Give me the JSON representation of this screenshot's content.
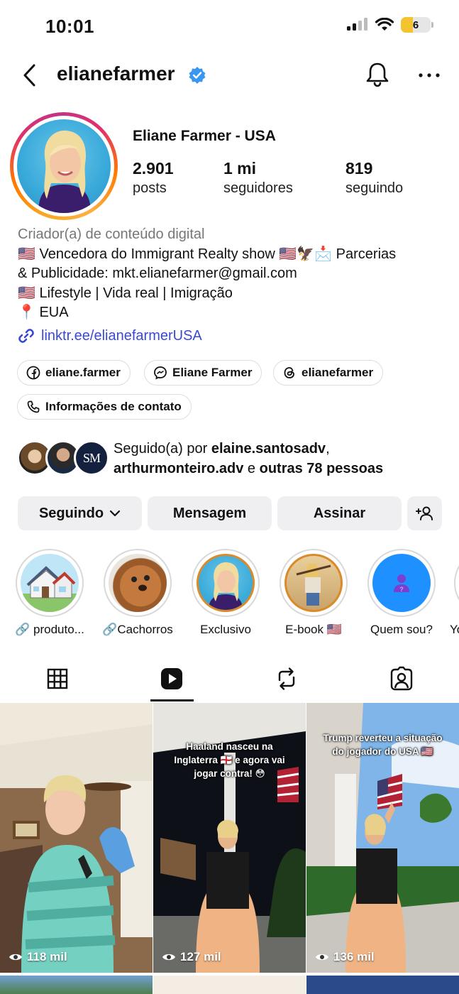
{
  "status": {
    "time": "10:01",
    "battery": "6"
  },
  "header": {
    "username": "elianefarmer"
  },
  "profile": {
    "display_name": "Eliane Farmer - USA",
    "stats": [
      {
        "value": "2.901",
        "label": "posts"
      },
      {
        "value": "1 mi",
        "label": "seguidores"
      },
      {
        "value": "819",
        "label": "seguindo"
      }
    ],
    "category": "Criador(a) de conteúdo digital",
    "bio_lines": [
      "🇺🇸 Vencedora do Immigrant Realty show 🇺🇸🦅📩 Parcerias",
      "& Publicidade: mkt.elianefarmer@gmail.com",
      "🇺🇸 Lifestyle | Vida real | Imigração",
      "📍 EUA"
    ],
    "link": "linktr.ee/elianefarmerUSA"
  },
  "chips": [
    {
      "label": "eliane.farmer",
      "icon": "facebook-icon"
    },
    {
      "label": "Eliane Farmer",
      "icon": "messenger-icon"
    },
    {
      "label": "elianefarmer",
      "icon": "threads-icon"
    },
    {
      "label": "Informações de contato",
      "icon": "phone-icon"
    }
  ],
  "followed_by": {
    "prefix": "Seguido(a) por ",
    "user1": "elaine.santosadv",
    "comma": ",",
    "user2": "arthurmonteiro.adv",
    "mid": " e ",
    "others": "outras 78 pessoas",
    "avatar3_text": "SM"
  },
  "actions": {
    "following": "Seguindo",
    "message": "Mensagem",
    "subscribe": "Assinar"
  },
  "highlights": [
    {
      "label": "🔗 produto..."
    },
    {
      "label": "🔗Cachorros"
    },
    {
      "label": "Exclusivo"
    },
    {
      "label": "E-book 🇺🇸"
    },
    {
      "label": "Quem sou?"
    },
    {
      "label": "Yo"
    }
  ],
  "tabs": [
    "grid-icon",
    "reels-icon",
    "reposts-icon",
    "tagged-icon"
  ],
  "posts": [
    {
      "views": "118 mil",
      "caption": ""
    },
    {
      "views": "127 mil",
      "caption": "Haaland nasceu na Inglaterra 🏴󠁧󠁢󠁥󠁮󠁧󠁿 e agora vai jogar contra! 😳"
    },
    {
      "views": "136 mil",
      "caption": "Trump reverteu a situação do jogador do USA 🇺🇸"
    }
  ],
  "colors": {
    "link": "#3a4ad0",
    "verified": "#3897f0",
    "button_bg": "#efeff1",
    "muted": "#777777"
  }
}
